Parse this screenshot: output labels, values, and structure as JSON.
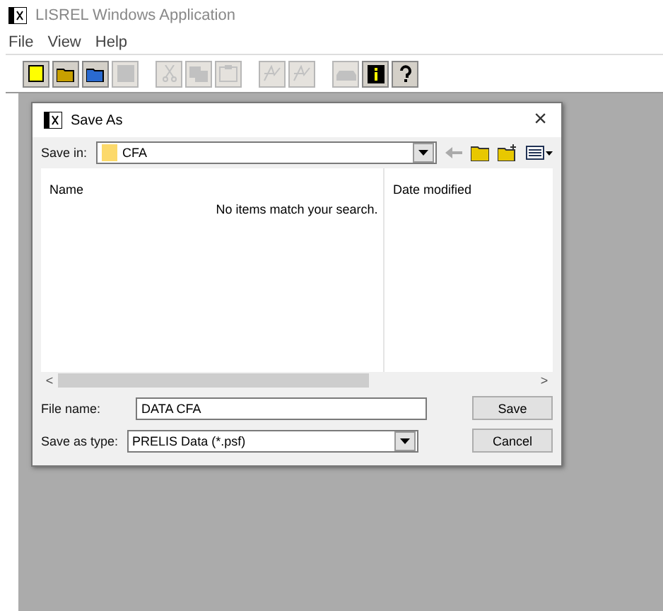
{
  "app": {
    "title": "LISREL Windows Application"
  },
  "menu": [
    "File",
    "View",
    "Help"
  ],
  "toolbar": [
    {
      "kind": "new",
      "disabled": false
    },
    {
      "kind": "open",
      "disabled": false
    },
    {
      "kind": "open-data",
      "disabled": false
    },
    {
      "kind": "save",
      "disabled": true
    },
    {
      "kind": "sep"
    },
    {
      "kind": "cut",
      "disabled": true
    },
    {
      "kind": "copy",
      "disabled": true
    },
    {
      "kind": "paste",
      "disabled": true
    },
    {
      "kind": "sep"
    },
    {
      "kind": "path",
      "disabled": true
    },
    {
      "kind": "path",
      "disabled": true
    },
    {
      "kind": "sep"
    },
    {
      "kind": "print",
      "disabled": true
    },
    {
      "kind": "info",
      "disabled": false
    },
    {
      "kind": "help",
      "disabled": false
    }
  ],
  "dialog": {
    "title": "Save As",
    "close": "×",
    "save_in_label": "Save in:",
    "save_in_value": "CFA",
    "columns": [
      "Name",
      "Date modified"
    ],
    "empty_message": "No items match your search.",
    "file_name_label": "File name:",
    "file_name_value": "DATA CFA",
    "type_label": "Save as type:",
    "type_value": "PRELIS Data (*.psf)",
    "scroll_left": "<",
    "scroll_right": ">",
    "buttons": [
      "Save",
      "Cancel"
    ]
  }
}
